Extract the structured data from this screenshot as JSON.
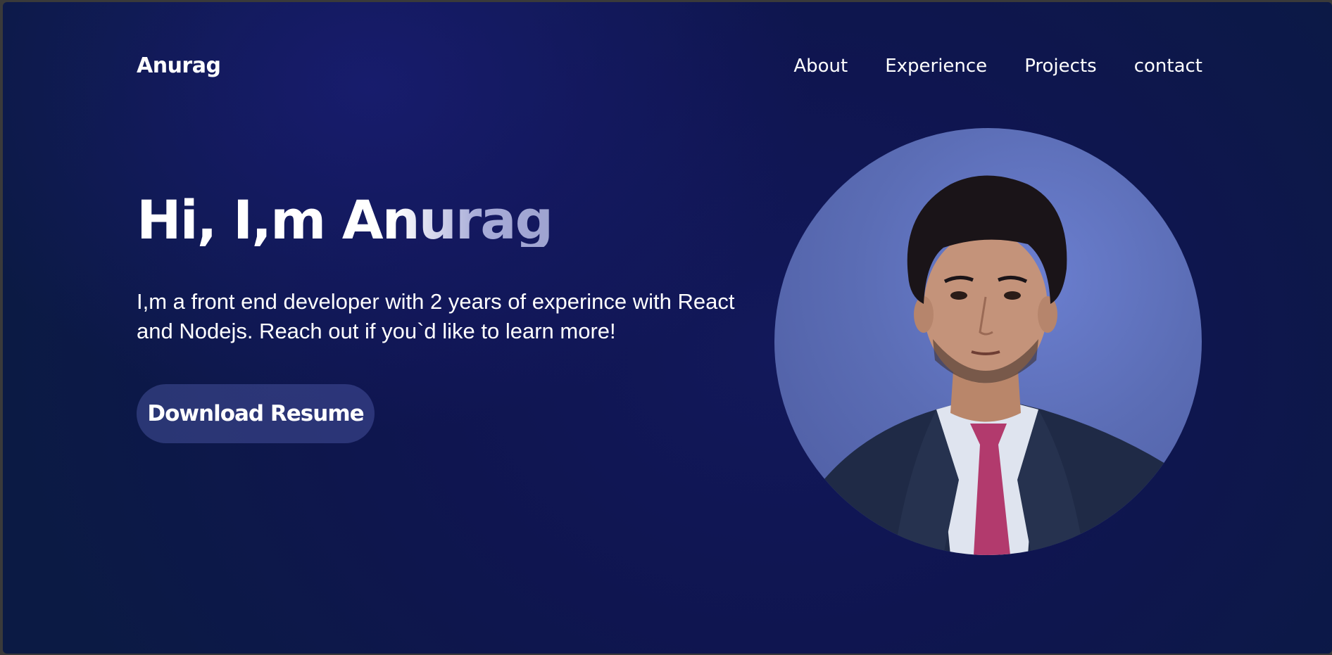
{
  "nav": {
    "logo": "Anurag",
    "links": [
      "About",
      "Experience",
      "Projects",
      "contact"
    ]
  },
  "hero": {
    "title": "Hi, I,m Anurag",
    "description": "I,m a front end developer with 2 years of experince with React and Nodejs. Reach out if you`d like to learn more!",
    "button_label": "Download Resume"
  },
  "icons": {
    "profile": "profile-photo"
  },
  "colors": {
    "background": "#12185a",
    "button_bg": "#3a4590",
    "avatar_bg": "#5b6db5",
    "text": "#ffffff"
  }
}
